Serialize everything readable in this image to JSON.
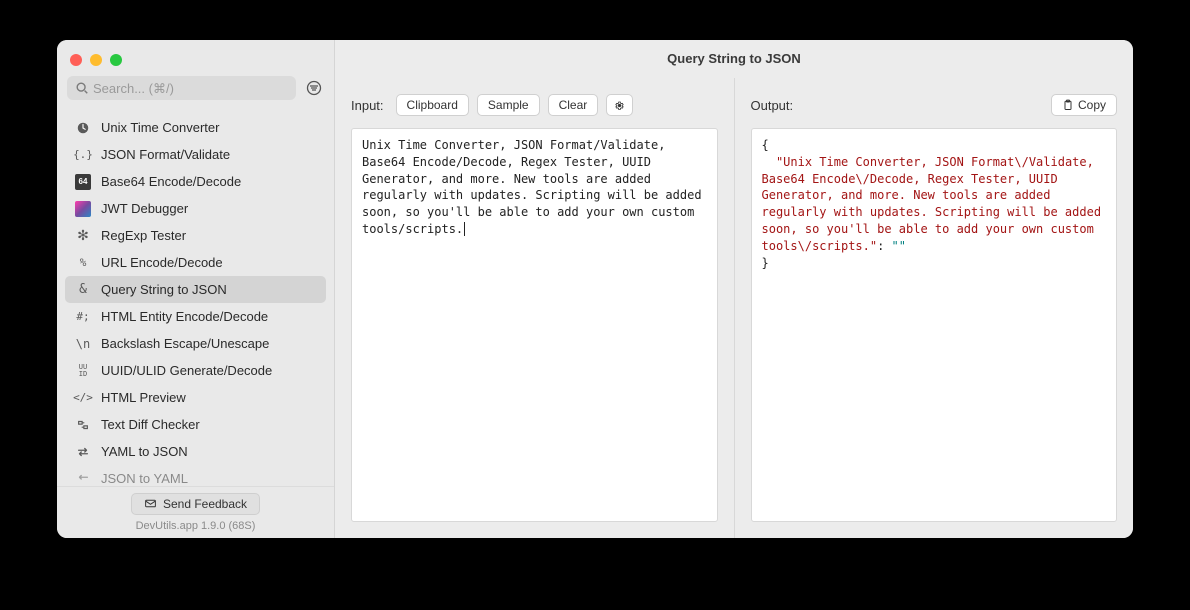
{
  "window": {
    "title": "Query String to JSON"
  },
  "search": {
    "placeholder": "Search... (⌘/)"
  },
  "sidebar": {
    "items": [
      {
        "label": "Unix Time Converter",
        "icon": "clock-icon"
      },
      {
        "label": "JSON Format/Validate",
        "icon": "braces-icon"
      },
      {
        "label": "Base64 Encode/Decode",
        "icon": "b64-icon"
      },
      {
        "label": "JWT Debugger",
        "icon": "jwt-icon"
      },
      {
        "label": "RegExp Tester",
        "icon": "regex-icon"
      },
      {
        "label": "URL Encode/Decode",
        "icon": "percent-icon"
      },
      {
        "label": "Query String to JSON",
        "icon": "ampersand-icon",
        "active": true
      },
      {
        "label": "HTML Entity Encode/Decode",
        "icon": "hash-icon"
      },
      {
        "label": "Backslash Escape/Unescape",
        "icon": "backslash-icon"
      },
      {
        "label": "UUID/ULID Generate/Decode",
        "icon": "uuid-icon"
      },
      {
        "label": "HTML Preview",
        "icon": "code-icon"
      },
      {
        "label": "Text Diff Checker",
        "icon": "diff-icon"
      },
      {
        "label": "YAML to JSON",
        "icon": "convert-icon"
      },
      {
        "label": "JSON to YAML",
        "icon": "convert-back-icon",
        "fade": true
      }
    ],
    "feedback_label": "Send Feedback",
    "version": "DevUtils.app 1.9.0 (68S)"
  },
  "input": {
    "label": "Input:",
    "buttons": {
      "clipboard": "Clipboard",
      "sample": "Sample",
      "clear": "Clear"
    },
    "text": "Unix Time Converter, JSON Format/Validate, Base64 Encode/Decode, Regex Tester, UUID Generator, and more. New tools are added regularly with updates. Scripting will be added soon, so you'll be able to add your own custom tools/scripts."
  },
  "output": {
    "label": "Output:",
    "copy_label": "Copy",
    "json_key": "\"Unix Time Converter, JSON Format\\/Validate, Base64 Encode\\/Decode, Regex Tester, UUID Generator, and more. New tools are added regularly with updates. Scripting will be added soon, so you'll be able to add your own custom tools\\/scripts.\"",
    "json_value": "\"\""
  }
}
